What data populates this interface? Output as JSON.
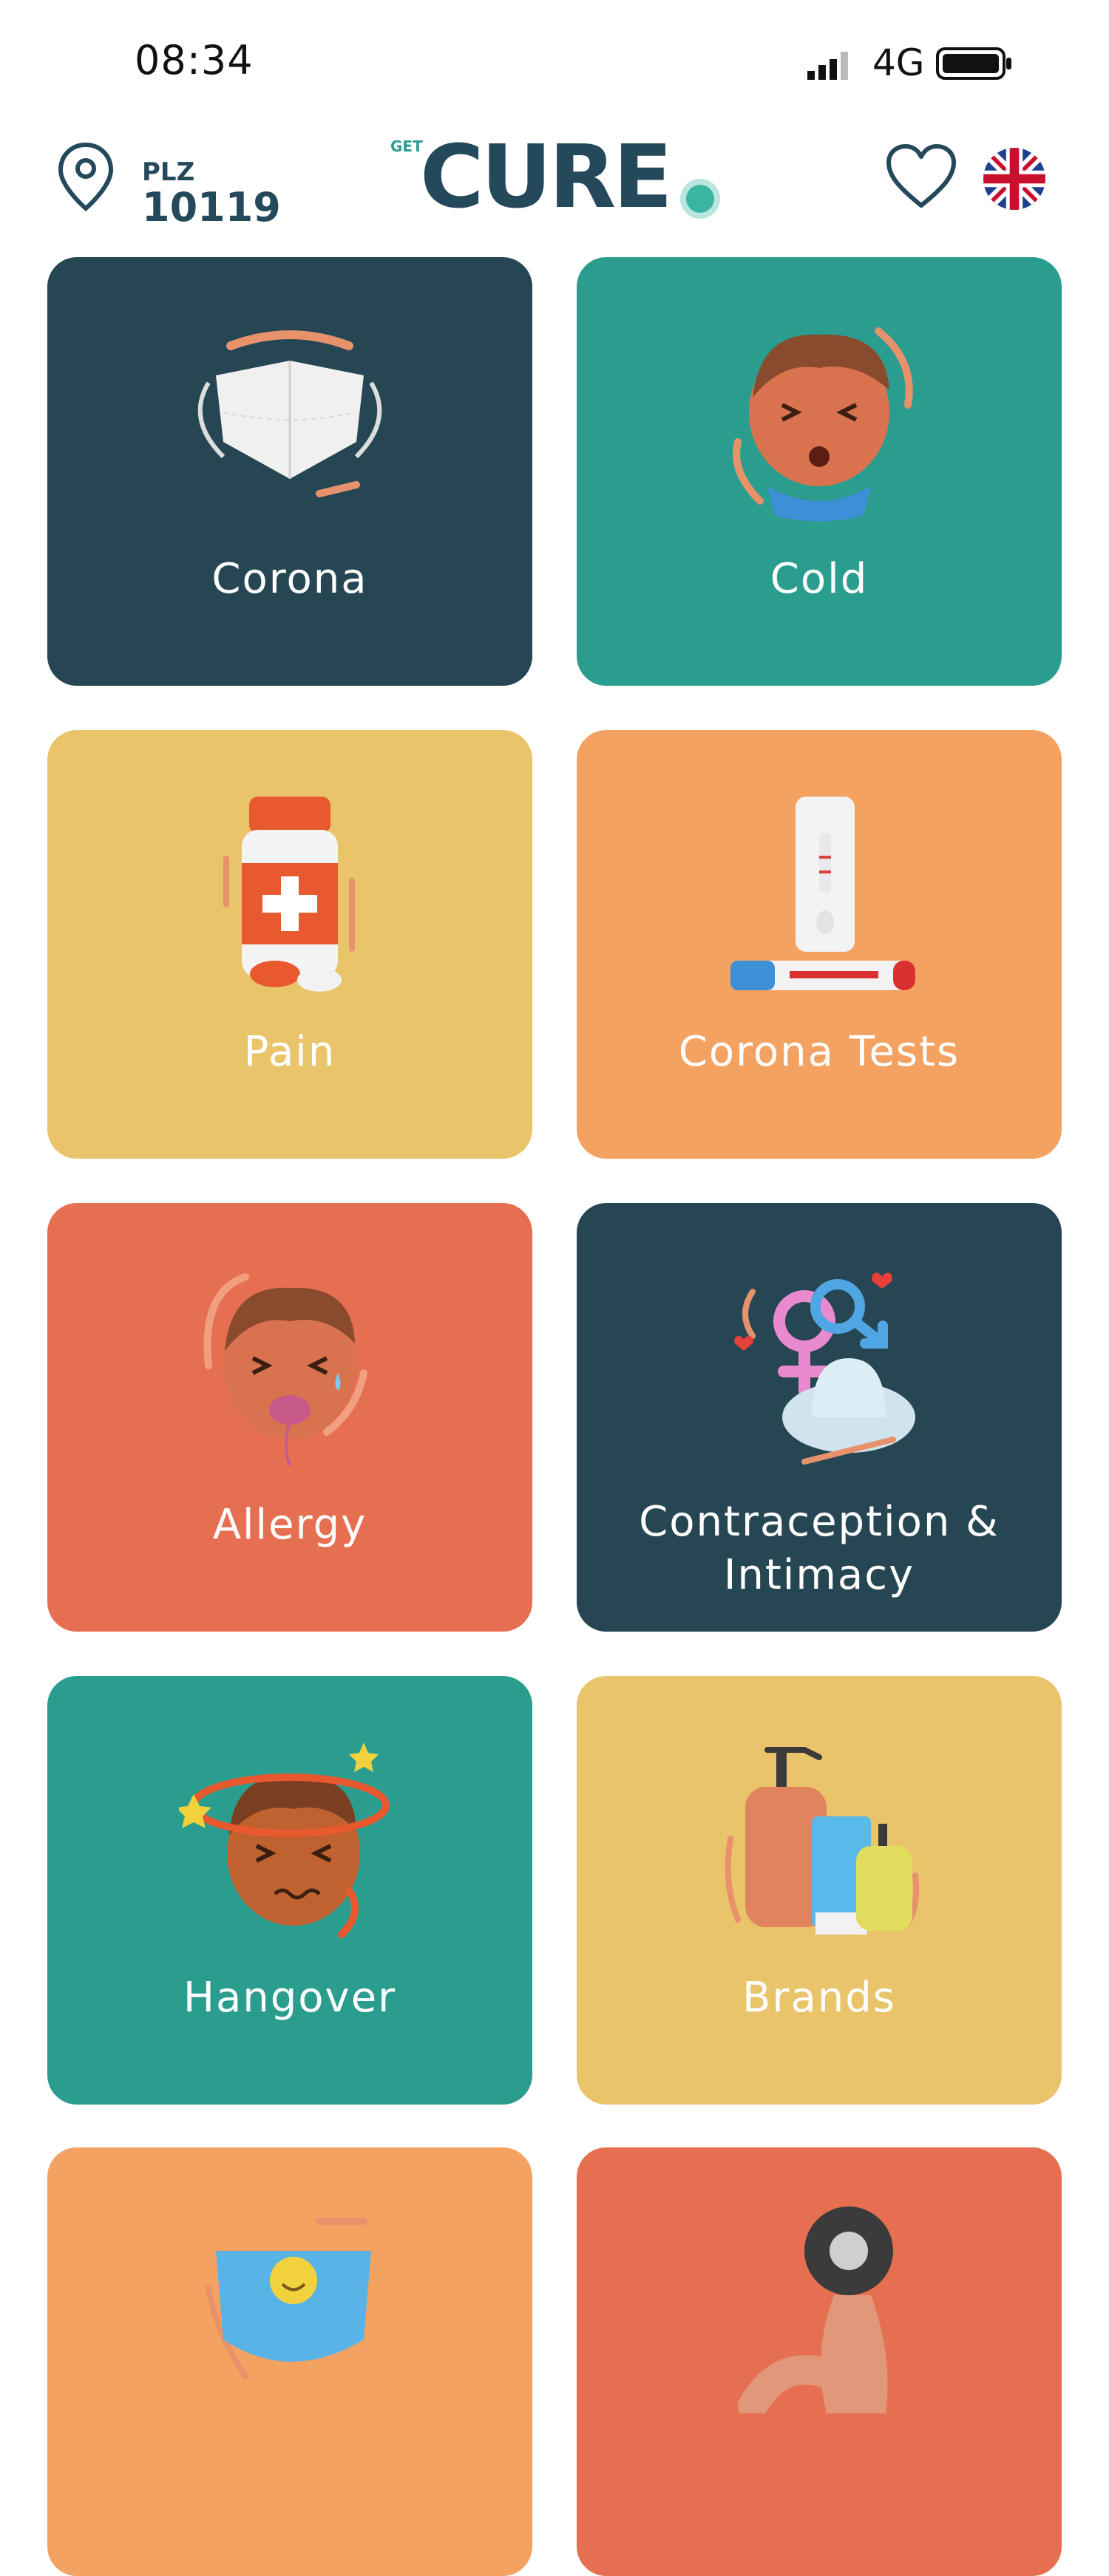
{
  "status_bar": {
    "time": "08:34",
    "network": "4G",
    "icons": [
      "signal-icon",
      "battery-icon"
    ]
  },
  "header": {
    "plz_label": "PLZ",
    "plz_value": "10119",
    "logo_small": "GET",
    "logo_main": "CURE",
    "icons": [
      "location-pin-icon",
      "heart-icon",
      "uk-flag-icon"
    ]
  },
  "colors": {
    "navy": "#264653",
    "teal": "#2a9d8f",
    "yellow": "#e9c46a",
    "orange": "#f4a261",
    "coral": "#e76f51"
  },
  "categories": [
    {
      "label": "Corona",
      "color": "#264653",
      "icon": "face-mask-icon"
    },
    {
      "label": "Cold",
      "color": "#2a9d8f",
      "icon": "sneezing-face-icon"
    },
    {
      "label": "Pain",
      "color": "#e9c46a",
      "icon": "pill-bottle-icon"
    },
    {
      "label": "Corona Tests",
      "color": "#f4a261",
      "icon": "covid-test-kit-icon"
    },
    {
      "label": "Allergy",
      "color": "#e76f51",
      "icon": "allergy-face-icon"
    },
    {
      "label": "Contraception & Intimacy",
      "color": "#264653",
      "icon": "gender-symbols-icon"
    },
    {
      "label": "Hangover",
      "color": "#2a9d8f",
      "icon": "dizzy-face-icon"
    },
    {
      "label": "Brands",
      "color": "#e9c46a",
      "icon": "cosmetic-bottles-icon"
    },
    {
      "label": "",
      "color": "#f4a261",
      "icon": "diaper-icon"
    },
    {
      "label": "",
      "color": "#e76f51",
      "icon": "flexed-arm-icon"
    }
  ]
}
